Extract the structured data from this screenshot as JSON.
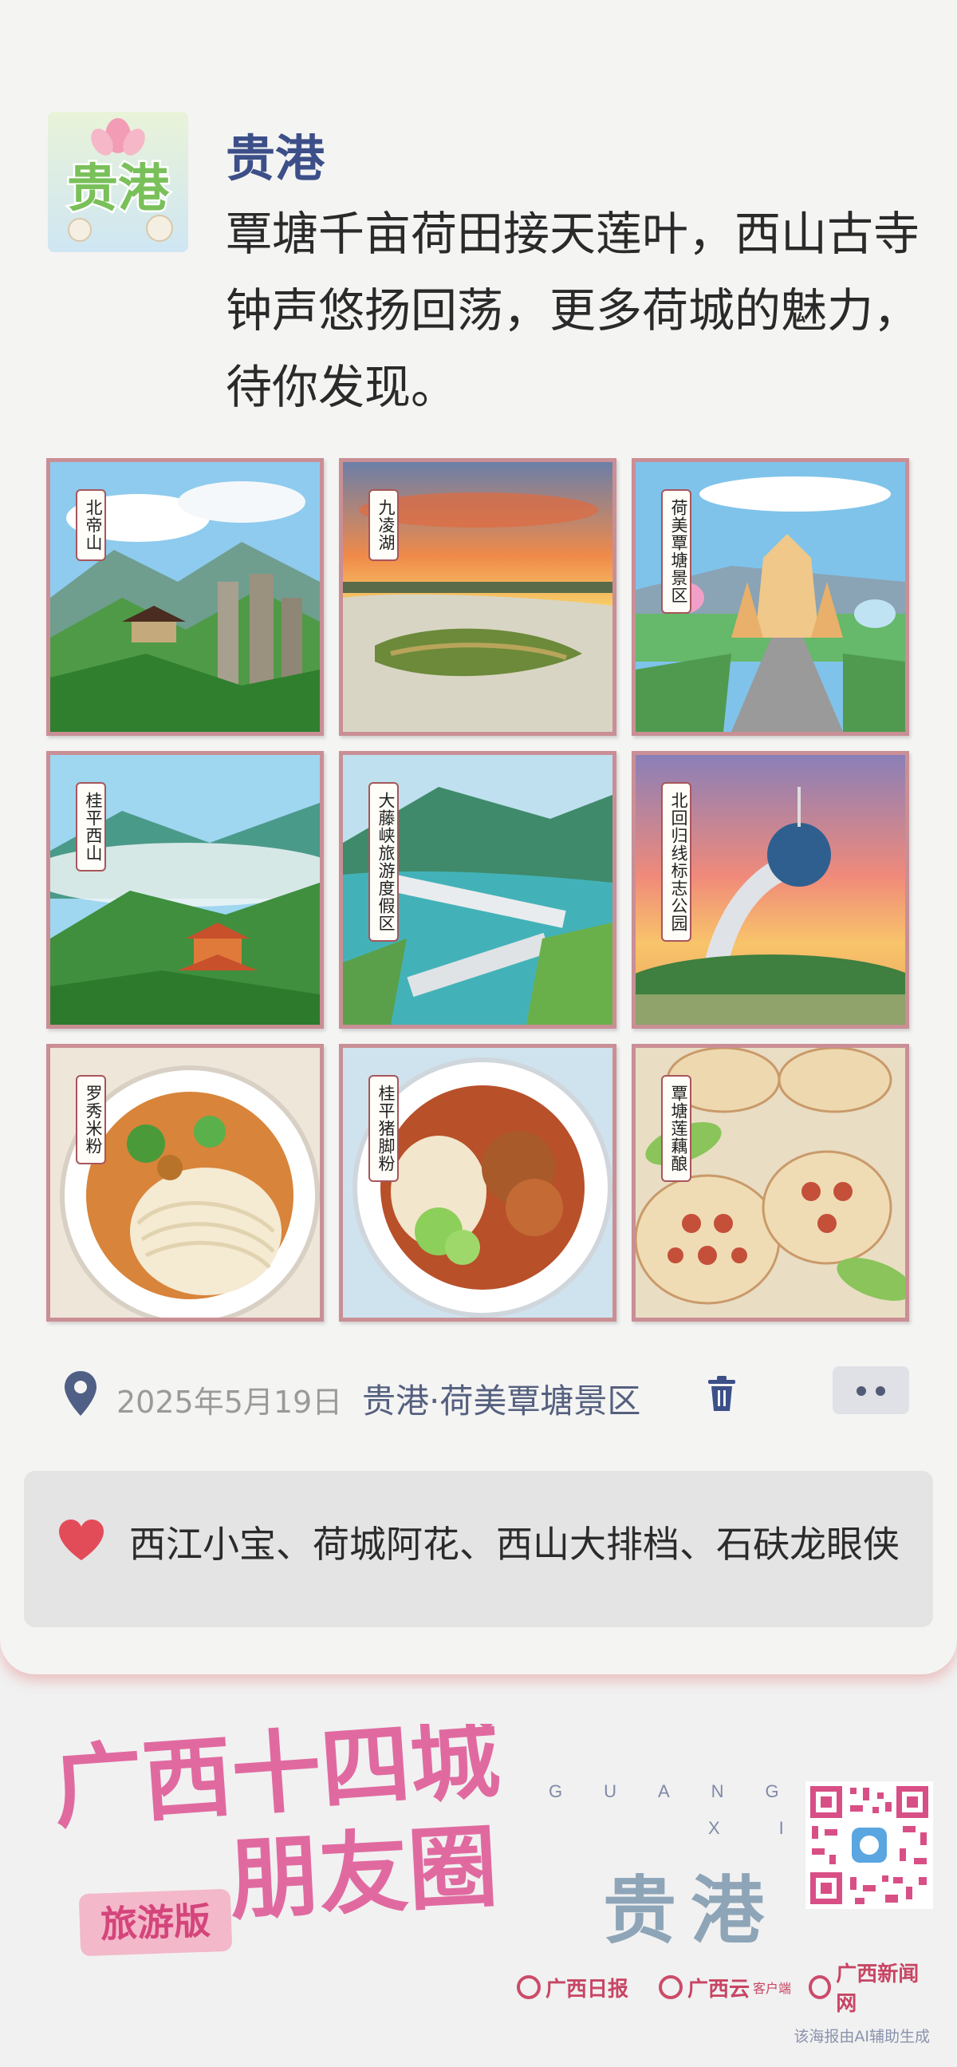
{
  "post": {
    "author": "贵港",
    "avatar_text": "贵港",
    "text": "覃塘千亩荷田接天莲叶，西山古寺钟声悠扬回荡，更多荷城的魅力，待你发现。"
  },
  "grid": [
    {
      "label": "北帝山",
      "scene": "mountain-pavilion"
    },
    {
      "label": "九凌湖",
      "scene": "lake-sunset"
    },
    {
      "label": "荷美覃塘景区",
      "scene": "lotus-gate"
    },
    {
      "label": "桂平西山",
      "scene": "misty-temple"
    },
    {
      "label": "大藤峡旅游度假区",
      "scene": "river-dam"
    },
    {
      "label": "北回归线标志公园",
      "scene": "globe-arch"
    },
    {
      "label": "罗秀米粉",
      "scene": "rice-noodles"
    },
    {
      "label": "桂平猪脚粉",
      "scene": "pork-noodles"
    },
    {
      "label": "覃塘莲藕酿",
      "scene": "lotus-root"
    }
  ],
  "meta": {
    "date": "2025年5月19日",
    "location": "贵港·荷美覃塘景区"
  },
  "likes": {
    "text": "西江小宝、荷城阿花、西山大排档、石砆龙眼侠"
  },
  "footer": {
    "series_title": "广西十四城朋友圈",
    "series_badge": "旅游版",
    "letters_top": "GUANG",
    "letters_bottom": "XI",
    "city": "贵港",
    "logos": [
      {
        "name": "广西日报"
      },
      {
        "name": "广西云",
        "suffix": "客户端"
      },
      {
        "name": "广西新闻网"
      }
    ],
    "ai_note": "该海报由AI辅助生成"
  },
  "colors": {
    "author": "#3c4f88",
    "accent_pink": "#d4457b",
    "heart": "#e24c58"
  }
}
